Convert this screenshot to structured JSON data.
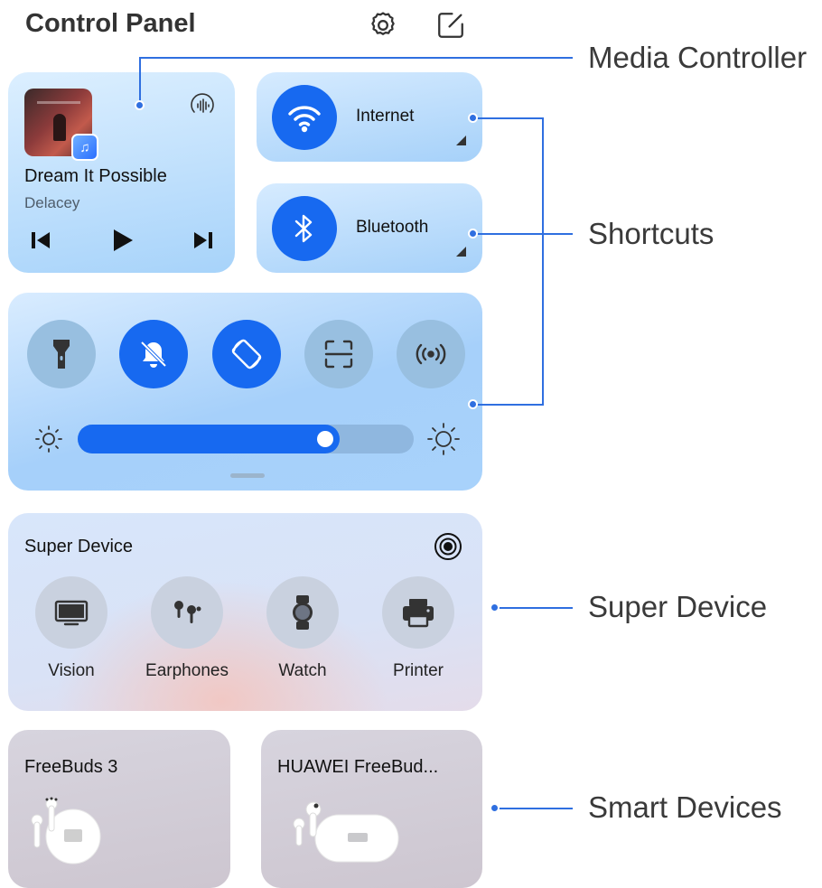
{
  "header": {
    "title": "Control Panel",
    "settings_icon": "gear-icon",
    "edit_icon": "edit-icon"
  },
  "media": {
    "song": "Dream It Possible",
    "artist": "Delacey",
    "controls": [
      "previous-icon",
      "play-icon",
      "next-icon"
    ]
  },
  "shortcuts": [
    {
      "label": "Internet",
      "icon": "wifi-icon"
    },
    {
      "label": "Bluetooth",
      "icon": "bluetooth-icon"
    }
  ],
  "toggles": [
    {
      "icon": "flashlight-icon",
      "on": false
    },
    {
      "icon": "silent-bell-icon",
      "on": true
    },
    {
      "icon": "auto-rotate-icon",
      "on": true
    },
    {
      "icon": "screenshot-icon",
      "on": false
    },
    {
      "icon": "hotspot-icon",
      "on": false
    }
  ],
  "brightness": {
    "level_percent": 78
  },
  "super_device": {
    "title": "Super Device",
    "items": [
      {
        "label": "Vision",
        "icon": "tv-icon"
      },
      {
        "label": "Earphones",
        "icon": "earphones-icon"
      },
      {
        "label": "Watch",
        "icon": "watch-icon"
      },
      {
        "label": "Printer",
        "icon": "printer-icon"
      }
    ]
  },
  "smart_devices": [
    {
      "title": "FreeBuds 3"
    },
    {
      "title": "HUAWEI FreeBud..."
    }
  ],
  "annotations": {
    "media_controller": "Media Controller",
    "shortcuts": "Shortcuts",
    "super_device": "Super Device",
    "smart_devices": "Smart Devices"
  },
  "colors": {
    "accent": "#1769f0",
    "annotation": "#2f6fe0"
  }
}
